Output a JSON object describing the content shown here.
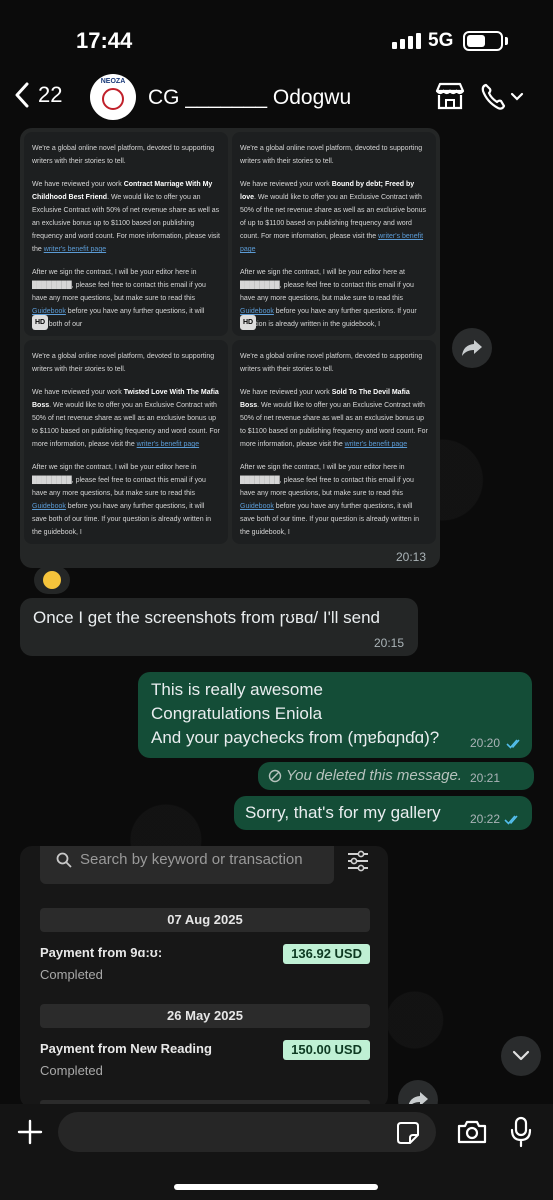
{
  "status_bar": {
    "time": "17:44",
    "network": "5G"
  },
  "header": {
    "back_count": "22",
    "contact_name": "CG _______ Odogwu",
    "avatar_text": "NEOZA"
  },
  "image_grid": {
    "tiles": [
      {
        "p1": "We're a global online novel platform, devoted to supporting writers with their stories to tell.",
        "p2_pre": "We have reviewed your work ",
        "p2_bold": "Contract Marriage With My Childhood Best Friend",
        "p2_post": ". We would like to offer you an Exclusive Contract with 50% of net revenue share as well as an exclusive bonus up to $1100 based on publishing frequency and word count. For more information, please visit the ",
        "p2_link": "writer's benefit page",
        "p3_pre": "After we sign the contract, I will be your editor here in ████████, please feel free to contact this email if you have any more questions, but make sure to read this ",
        "p3_link": "Guidebook",
        "p3_post": " before you have any further questions, it will save both of our"
      },
      {
        "p1": "We're a global online novel platform, devoted to supporting writers with their stories to tell.",
        "p2_pre": "We have reviewed your work ",
        "p2_bold": "Bound by debt; Freed by love",
        "p2_post": ". We would like to offer you an Exclusive Contract with 50% of the net revenue share as well as an exclusive bonus of up to $1100 based on publishing frequency and word count. For more information, please visit the ",
        "p2_link": "writer's benefit page",
        "p3_pre": "After we sign the contract, I will be your editor here at ████████, please feel free to contact this email if you have any more questions, but make sure to read this ",
        "p3_link": "Guidebook",
        "p3_post": " before you have any further questions. If your question is already written in the guidebook, I"
      },
      {
        "p1": "We're a global online novel platform, devoted to supporting writers with their stories to tell.",
        "p2_pre": "We have reviewed your work ",
        "p2_bold": "Twisted Love With The Mafia Boss",
        "p2_post": ". We would like to offer you an Exclusive Contract with 50% of net revenue share as well as an exclusive bonus up to $1100 based on publishing frequency and word count. For more information, please visit the ",
        "p2_link": "writer's benefit page",
        "p3_pre": "After we sign the contract, I will be your editor here in ████████, please feel free to contact this email if you have any more questions, but make sure to read this ",
        "p3_link": "Guidebook",
        "p3_post": " before you have any further questions, it will save both of our time. If your question is already written in the guidebook, I"
      },
      {
        "p1": "We're a global online novel platform, devoted to supporting writers with their stories to tell.",
        "p2_pre": "We have reviewed your work ",
        "p2_bold": "Sold To The Devil Mafia Boss",
        "p2_post": ". We would like to offer you an Exclusive Contract with 50% of net revenue share as well as an exclusive bonus up to $1100 based on publishing frequency and word count. For more information, please visit the ",
        "p2_link": "writer's benefit page",
        "p3_pre": "After we sign the contract, I will be your editor here in ████████, please feel free to contact this email if you have any more questions, but make sure to read this ",
        "p3_link": "Guidebook",
        "p3_post": " before you have any further questions, it will save both of our time. If your question is already written in the guidebook, I"
      }
    ],
    "hd_label": "HD",
    "time": "20:13"
  },
  "messages": {
    "m1_text": "Once I get the screenshots from ɼʊʙɑ/ I'll send",
    "m1_time": "20:15",
    "m2_lines": [
      "This is really awesome",
      "Congratulations Eniola",
      "And your paychecks from (ɱɐɓɑɲɗɑ)?"
    ],
    "m2_time": "20:20",
    "deleted_text": "You deleted this message.",
    "deleted_time": "20:21",
    "m3_text": "Sorry, that's for my gallery",
    "m3_time": "20:22"
  },
  "screenshot": {
    "search_placeholder": "Search by keyword or transaction",
    "transactions": [
      {
        "date": "07 Aug 2025",
        "title": "Payment from 9ɑ:ʊ:",
        "status": "Completed",
        "amount": "136.92 USD"
      },
      {
        "date": "26 May 2025",
        "title": "Payment from New Reading",
        "status": "Completed",
        "amount": "150.00 USD"
      }
    ]
  },
  "colors": {
    "outgoing": "#144d37",
    "incoming": "#242626",
    "read_ticks": "#53bdeb",
    "amount_bg": "#bff0d4"
  }
}
